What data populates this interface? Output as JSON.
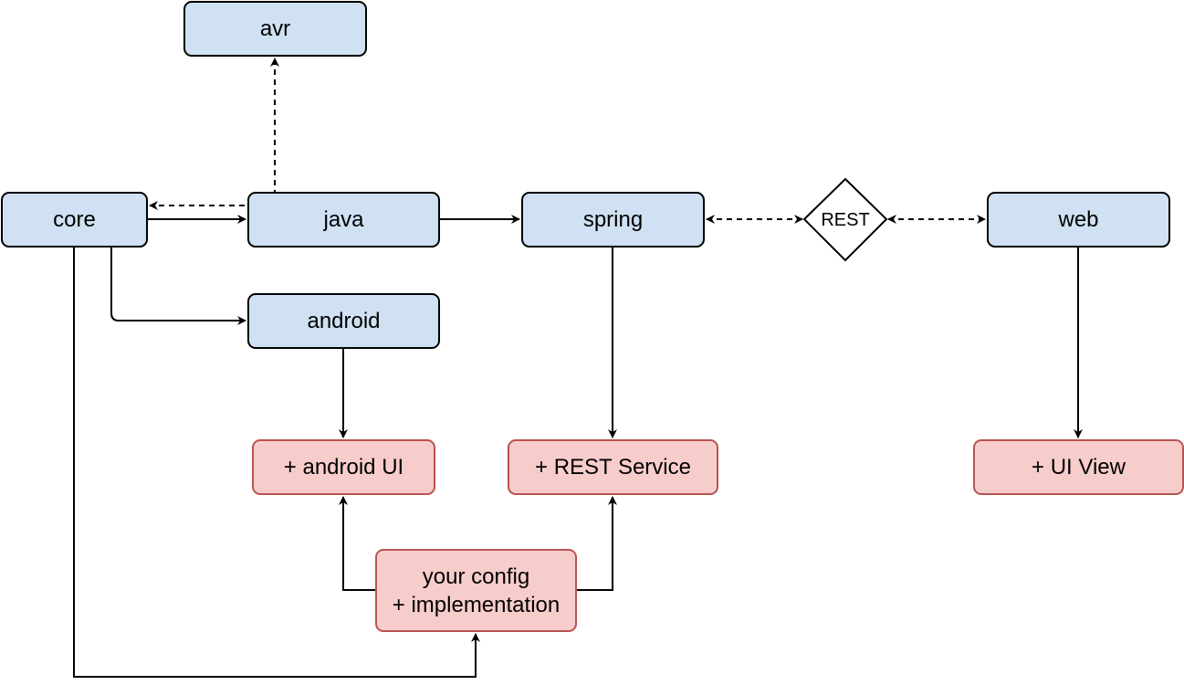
{
  "diagram": {
    "nodes": {
      "avr": {
        "label": "avr",
        "kind": "module",
        "fill": "#cfe1f2",
        "stroke": "#000000"
      },
      "core": {
        "label": "core",
        "kind": "module",
        "fill": "#cfe1f2",
        "stroke": "#000000"
      },
      "java": {
        "label": "java",
        "kind": "module",
        "fill": "#cfe1f2",
        "stroke": "#000000"
      },
      "spring": {
        "label": "spring",
        "kind": "module",
        "fill": "#cfe1f2",
        "stroke": "#000000"
      },
      "web": {
        "label": "web",
        "kind": "module",
        "fill": "#cfe1f2",
        "stroke": "#000000"
      },
      "android": {
        "label": "android",
        "kind": "module",
        "fill": "#cfe1f2",
        "stroke": "#000000"
      },
      "android_ui": {
        "label": "+ android UI",
        "kind": "user-addition",
        "fill": "#f7cdcc",
        "stroke": "#b85450"
      },
      "rest_service": {
        "label": "+ REST Service",
        "kind": "user-addition",
        "fill": "#f7cdcc",
        "stroke": "#b85450"
      },
      "ui_view": {
        "label": "+ UI View",
        "kind": "user-addition",
        "fill": "#f7cdcc",
        "stroke": "#b85450"
      },
      "config_line1": "your config",
      "config_line2": "+ implementation",
      "rest": {
        "label": "REST",
        "kind": "decision-diamond"
      }
    },
    "edges": [
      {
        "from": "core",
        "to": "java",
        "style": "solid"
      },
      {
        "from": "java",
        "to": "core",
        "style": "dashed"
      },
      {
        "from": "java",
        "to": "avr",
        "style": "dashed"
      },
      {
        "from": "java",
        "to": "spring",
        "style": "solid"
      },
      {
        "from": "spring",
        "to": "rest",
        "style": "dashed",
        "bidirectional": true
      },
      {
        "from": "rest",
        "to": "web",
        "style": "dashed",
        "bidirectional": true
      },
      {
        "from": "core",
        "to": "android",
        "style": "solid"
      },
      {
        "from": "android",
        "to": "android_ui",
        "style": "solid"
      },
      {
        "from": "spring",
        "to": "rest_service",
        "style": "solid"
      },
      {
        "from": "web",
        "to": "ui_view",
        "style": "solid"
      },
      {
        "from": "config",
        "to": "android_ui",
        "style": "solid"
      },
      {
        "from": "config",
        "to": "rest_service",
        "style": "solid"
      },
      {
        "from": "core",
        "to": "config",
        "style": "solid"
      }
    ]
  }
}
